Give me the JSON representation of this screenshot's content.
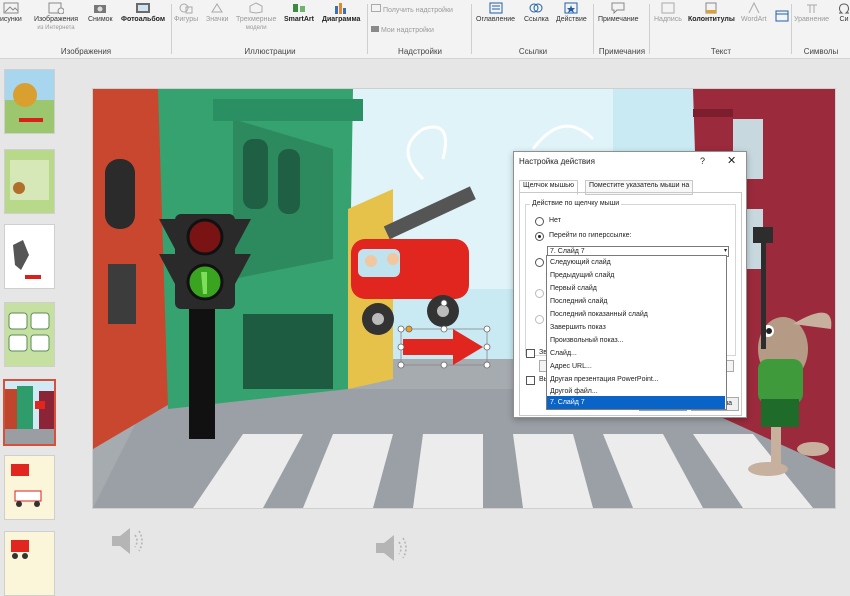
{
  "ribbon": {
    "groups": [
      {
        "label": "Изображения"
      },
      {
        "label": "Иллюстрации"
      },
      {
        "label": "Надстройки"
      },
      {
        "label": "Ссылки"
      },
      {
        "label": "Примечания"
      },
      {
        "label": "Текст"
      },
      {
        "label": "Символы"
      }
    ],
    "buttons": {
      "risunki": "исунки",
      "internet_images": "Изображения",
      "internet_images_sub": "из Интернета",
      "snimok": "Снимок",
      "photoalbum": "Фотоальбом",
      "figury": "Фигуры",
      "znachki": "Значки",
      "models3d": "Трехмерные",
      "models3d_sub": "модели",
      "smartart": "SmartArt",
      "diagramma": "Диаграмма",
      "get_addins": "Получить надстройки",
      "my_addins": "Мои надстройки",
      "oglavlenie": "Оглавление",
      "ssylka": "Ссылка",
      "deystvie": "Действие",
      "primechanie": "Примечание",
      "nadpis": "Надпись",
      "kolontituly": "Колонтитулы",
      "wordart": "WordArt",
      "uravnenie": "Уравнение",
      "simvol": "Си"
    }
  },
  "dialog": {
    "title": "Настройка действия",
    "help": "?",
    "close": "✕",
    "tabs": [
      "Щелчок мышью",
      "Поместите указатель мыши на"
    ],
    "fieldset_legend": "Действие по щелчку мыши",
    "options": {
      "none": "Нет",
      "hyperlink": "Перейти по гиперссылке:"
    },
    "selected_target": "7. Слайд 7",
    "checkbox1": "Зв",
    "checkbox2": "Вы",
    "hidden_button": "на"
  },
  "dropdown": {
    "items": [
      "Следующий слайд",
      "Предыдущий слайд",
      "Первый слайд",
      "Последний слайд",
      "Последний показанный слайд",
      "Завершить показ",
      "Произвольный показ...",
      "Слайд...",
      "Адрес URL...",
      "Другая презентация PowerPoint...",
      "Другой файл...",
      "7. Слайд 7"
    ],
    "selected_index": 11
  },
  "icons": {
    "speaker": "speaker-icon",
    "close": "close-icon",
    "help": "help-icon",
    "chevron": "chevron-down-icon"
  },
  "colors": {
    "selection": "#0a64c8",
    "selected_thumb_border": "#d6513b",
    "ribbon_bg": "#f3f3f3"
  }
}
